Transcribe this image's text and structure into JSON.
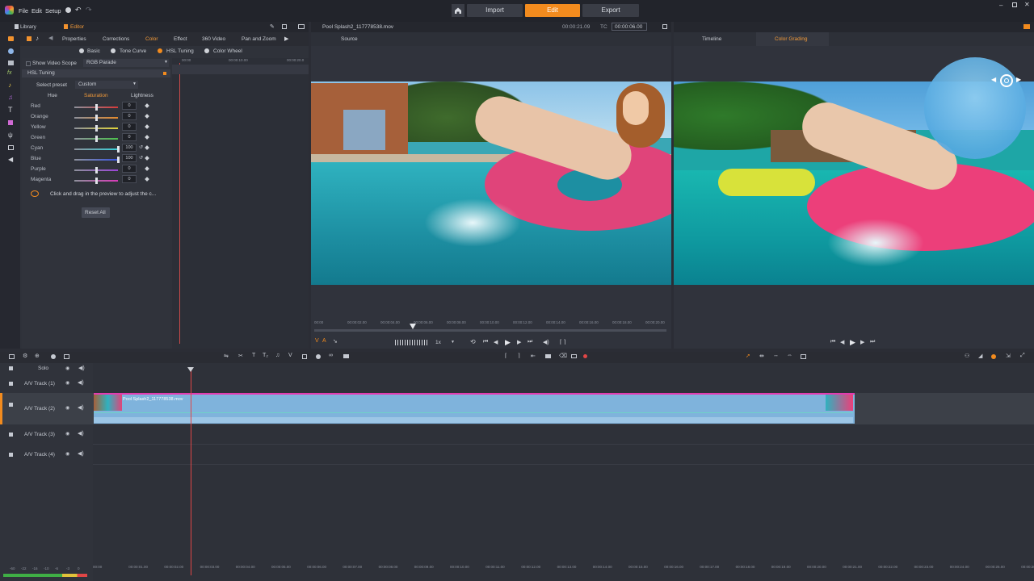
{
  "menu": {
    "file": "File",
    "edit": "Edit",
    "setup": "Setup"
  },
  "top_tabs": {
    "import": "Import",
    "edit": "Edit",
    "export": "Export"
  },
  "left_tabs": {
    "library": "Library",
    "editor": "Editor"
  },
  "editor_tabs": [
    "Properties",
    "Corrections",
    "Color",
    "Effect",
    "360 Video",
    "Pan and Zoom"
  ],
  "color_subtabs": [
    "Basic",
    "Tone Curve",
    "HSL Tuning",
    "Color Wheel"
  ],
  "show_video_scope": "Show Video Scope",
  "scope_select": "RGB Parade",
  "hsl_section": "HSL Tuning",
  "preset_label": "Select preset",
  "preset_value": "Custom",
  "hsl_tabs": [
    "Hue",
    "Saturation",
    "Lightness"
  ],
  "sliders": [
    {
      "label": "Red",
      "value": "0",
      "color": "#d63a3a",
      "level": 0.5
    },
    {
      "label": "Orange",
      "value": "0",
      "color": "#e48a2c",
      "level": 0.5
    },
    {
      "label": "Yellow",
      "value": "0",
      "color": "#e0d43a",
      "level": 0.5
    },
    {
      "label": "Green",
      "value": "0",
      "color": "#4cc24c",
      "level": 0.5
    },
    {
      "label": "Cyan",
      "value": "100",
      "color": "#36d0d8",
      "level": 1.0
    },
    {
      "label": "Blue",
      "value": "100",
      "color": "#3a55e0",
      "level": 1.0
    },
    {
      "label": "Purple",
      "value": "0",
      "color": "#9a45d8",
      "level": 0.5
    },
    {
      "label": "Magenta",
      "value": "0",
      "color": "#d83ab8",
      "level": 0.5
    }
  ],
  "hint": "Click and drag in the preview to adjust the c...",
  "reset_all": "Reset All",
  "keyframe_ruler": [
    "00:00",
    "00:00:10.00",
    "00:00:20.0"
  ],
  "source_file": "Pool Splash2_117778538.mov",
  "timecode_duration": "00:00:21.09",
  "timecode_position": "00:00:06.00",
  "tc_label": "TC",
  "source_tab": "Source",
  "right_tabs": {
    "timeline": "Timeline",
    "color_grading": "Color Grading"
  },
  "player_ruler": [
    "00:00",
    "00:00:02.00",
    "00:00:04.00",
    "00:00:06.00",
    "00:00:08.00",
    "00:00:10.00",
    "00:00:12.00",
    "00:00:14.00",
    "00:00:16.00",
    "00:00:18.00",
    "00:00:20.00"
  ],
  "playback_speed": "1x",
  "solo_label": "Solo",
  "tracks": [
    "A/V Track (1)",
    "A/V Track (2)",
    "A/V Track (3)",
    "A/V Track (4)"
  ],
  "clip_name": "Pool Splash2_117778538.mov",
  "timeline_ruler": [
    "00:00",
    "00:00:01.00",
    "00:00:02.00",
    "00:00:03.00",
    "00:00:04.00",
    "00:00:05.00",
    "00:00:06.00",
    "00:00:07.00",
    "00:00:08.00",
    "00:00:09.00",
    "00:00:10.00",
    "00:00:11.00",
    "00:00:12.00",
    "00:00:13.00",
    "00:00:14.00",
    "00:00:15.00",
    "00:00:16.00",
    "00:00:17.00",
    "00:00:18.00",
    "00:00:19.00",
    "00:00:20.00",
    "00:00:21.00",
    "00:00:22.00",
    "00:00:23.00",
    "00:00:24.00",
    "00:00:25.00",
    "00:00:26.00"
  ],
  "audio_meter": [
    "-60",
    "-22",
    "-16",
    "-10",
    "-6",
    "-3",
    "0"
  ],
  "colors": {
    "accent": "#f28b1e",
    "clip": "#7fb3dc",
    "clip_border": "#e23bb0",
    "playhead": "#e04646"
  }
}
